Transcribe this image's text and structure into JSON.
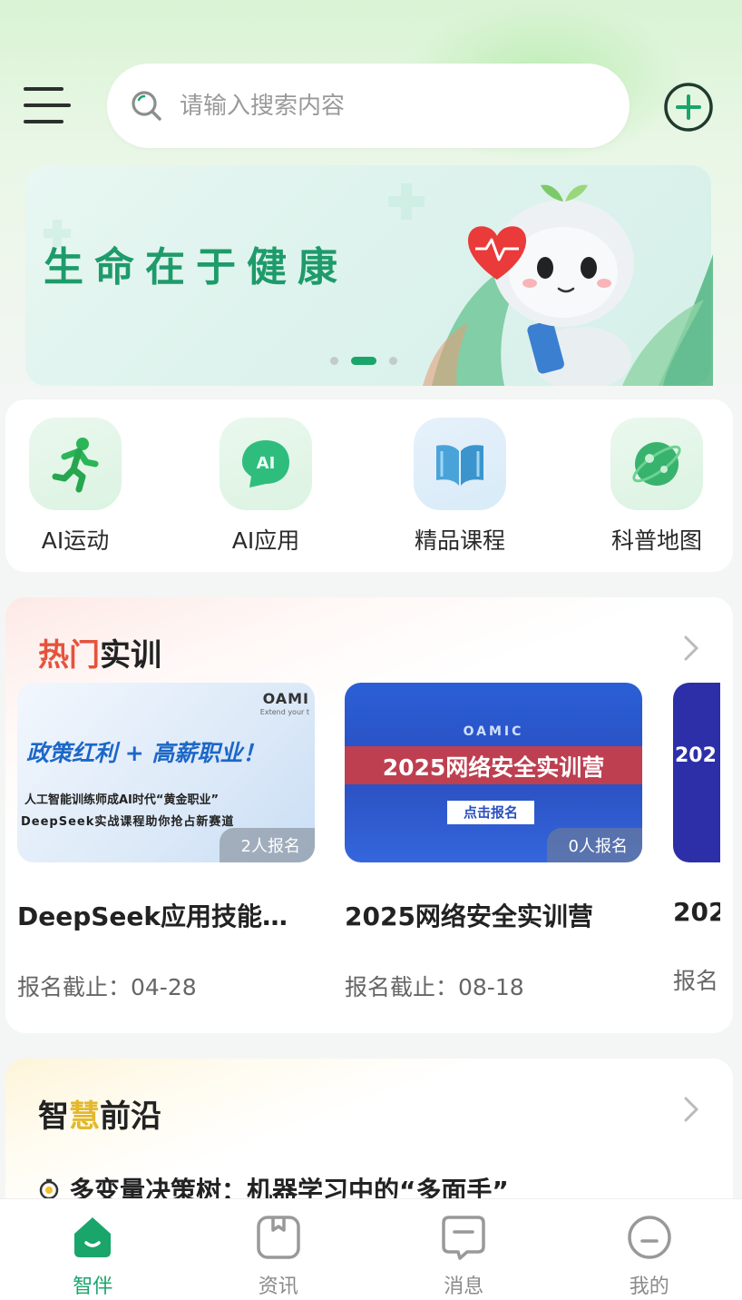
{
  "header": {
    "search_placeholder": "请输入搜索内容"
  },
  "banner": {
    "text": "生命在于健康",
    "slide_count": 3,
    "active_slide": 2
  },
  "quick_actions": [
    {
      "label": "AI运动",
      "icon": "running-person-icon"
    },
    {
      "label": "AI应用",
      "icon": "ai-chat-icon"
    },
    {
      "label": "精品课程",
      "icon": "open-book-icon"
    },
    {
      "label": "科普地图",
      "icon": "planet-map-icon"
    }
  ],
  "hot_training": {
    "title_highlight": "热门",
    "title_rest": "实训",
    "courses": [
      {
        "title": "DeepSeek应用技能…",
        "deadline": "报名截止：04-28",
        "signups": "2人报名",
        "thumb_brand": "OAMI",
        "thumb_sub": "Extend your t",
        "thumb_headline": "政策红利 + 高薪职业！",
        "thumb_line1": "人工智能训练师成AI时代“黄金职业”",
        "thumb_line2": "DeepSeek实战课程助你抢占新赛道"
      },
      {
        "title": "2025网络安全实训营",
        "deadline": "报名截止：08-18",
        "signups": "0人报名",
        "thumb_brand": "OAMIC",
        "thumb_headline": "2025网络安全实训营",
        "thumb_button": "点击报名"
      },
      {
        "title": "202",
        "deadline": "报名",
        "thumb_headline": "202"
      }
    ]
  },
  "frontier": {
    "title_pre": "智",
    "title_highlight": "慧",
    "title_rest": "前沿",
    "items": [
      {
        "title": "多变量决策树：机器学习中的“多面手”"
      }
    ]
  },
  "tabbar": [
    {
      "label": "智伴",
      "icon": "home-icon",
      "active": true
    },
    {
      "label": "资讯",
      "icon": "news-icon",
      "active": false
    },
    {
      "label": "消息",
      "icon": "message-icon",
      "active": false
    },
    {
      "label": "我的",
      "icon": "profile-icon",
      "active": false
    }
  ],
  "colors": {
    "accent": "#1aa56b",
    "hot_red": "#e5533c",
    "gold": "#e3b82b"
  }
}
